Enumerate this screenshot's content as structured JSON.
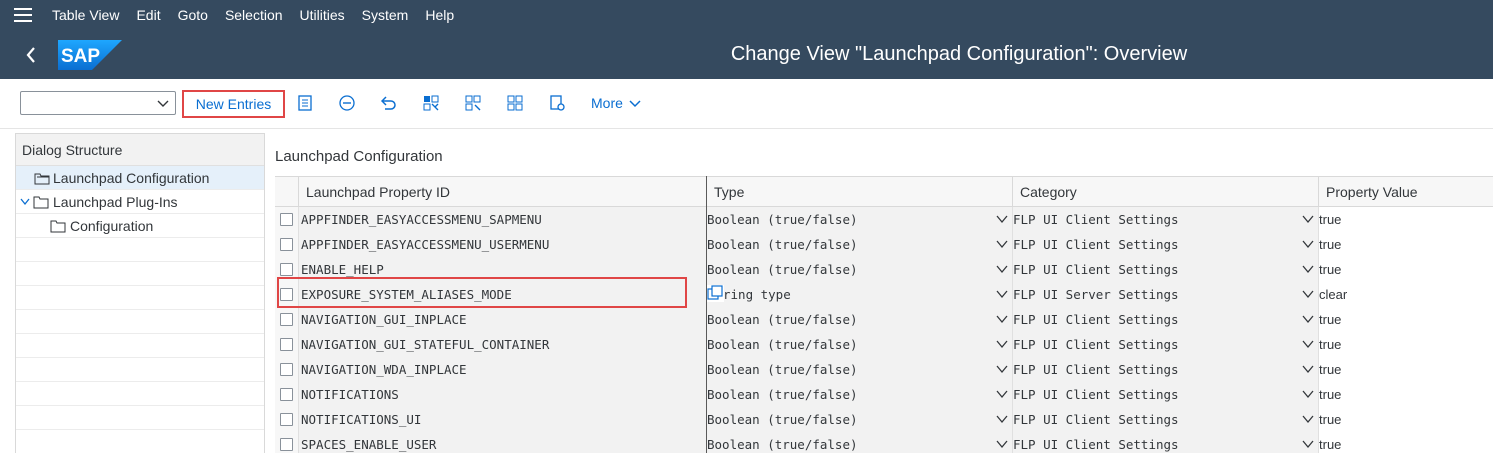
{
  "menubar": {
    "items": [
      "Table View",
      "Edit",
      "Goto",
      "Selection",
      "Utilities",
      "System",
      "Help"
    ]
  },
  "titlebar": {
    "logo_text": "SAP",
    "title": "Change View \"Launchpad Configuration\": Overview"
  },
  "toolbar": {
    "combo_value": "",
    "new_entries_label": "New Entries",
    "more_label": "More",
    "icons": [
      "details-icon",
      "delete-icon",
      "undo-icon",
      "select-all-icon",
      "select-block-icon",
      "deselect-all-icon",
      "config-icon"
    ]
  },
  "dialog_structure": {
    "header": "Dialog Structure",
    "items": [
      {
        "label": "Launchpad Configuration",
        "selected": true
      },
      {
        "label": "Launchpad Plug-Ins",
        "selected": false
      },
      {
        "label": "Configuration",
        "selected": false
      }
    ]
  },
  "section": {
    "title": "Launchpad Configuration"
  },
  "table": {
    "columns": [
      "Launchpad Property ID",
      "Type",
      "Category",
      "Property Value"
    ],
    "rows": [
      {
        "id": "APPFINDER_EASYACCESSMENU_SAPMENU",
        "type": "Boolean (true/false)",
        "category": "FLP UI Client Settings",
        "value": "true"
      },
      {
        "id": "APPFINDER_EASYACCESSMENU_USERMENU",
        "type": "Boolean (true/false)",
        "category": "FLP UI Client Settings",
        "value": "true"
      },
      {
        "id": "ENABLE_HELP",
        "type": "Boolean (true/false)",
        "category": "FLP UI Client Settings",
        "value": "true"
      },
      {
        "id": "EXPOSURE_SYSTEM_ALIASES_MODE",
        "type": "ring type",
        "category": "FLP UI Server Settings",
        "value": "clear"
      },
      {
        "id": "NAVIGATION_GUI_INPLACE",
        "type": "Boolean (true/false)",
        "category": "FLP UI Client Settings",
        "value": "true"
      },
      {
        "id": "NAVIGATION_GUI_STATEFUL_CONTAINER",
        "type": "Boolean (true/false)",
        "category": "FLP UI Client Settings",
        "value": "true"
      },
      {
        "id": "NAVIGATION_WDA_INPLACE",
        "type": "Boolean (true/false)",
        "category": "FLP UI Client Settings",
        "value": "true"
      },
      {
        "id": "NOTIFICATIONS",
        "type": "Boolean (true/false)",
        "category": "FLP UI Client Settings",
        "value": "true"
      },
      {
        "id": "NOTIFICATIONS_UI",
        "type": "Boolean (true/false)",
        "category": "FLP UI Client Settings",
        "value": "true"
      },
      {
        "id": "SPACES_ENABLE_USER",
        "type": "Boolean (true/false)",
        "category": "FLP UI Client Settings",
        "value": "true"
      }
    ]
  },
  "colors": {
    "shell": "#354a5f",
    "accent": "#0a6ed1",
    "highlight": "#e04646",
    "selected_row": "#e5f0fa"
  }
}
